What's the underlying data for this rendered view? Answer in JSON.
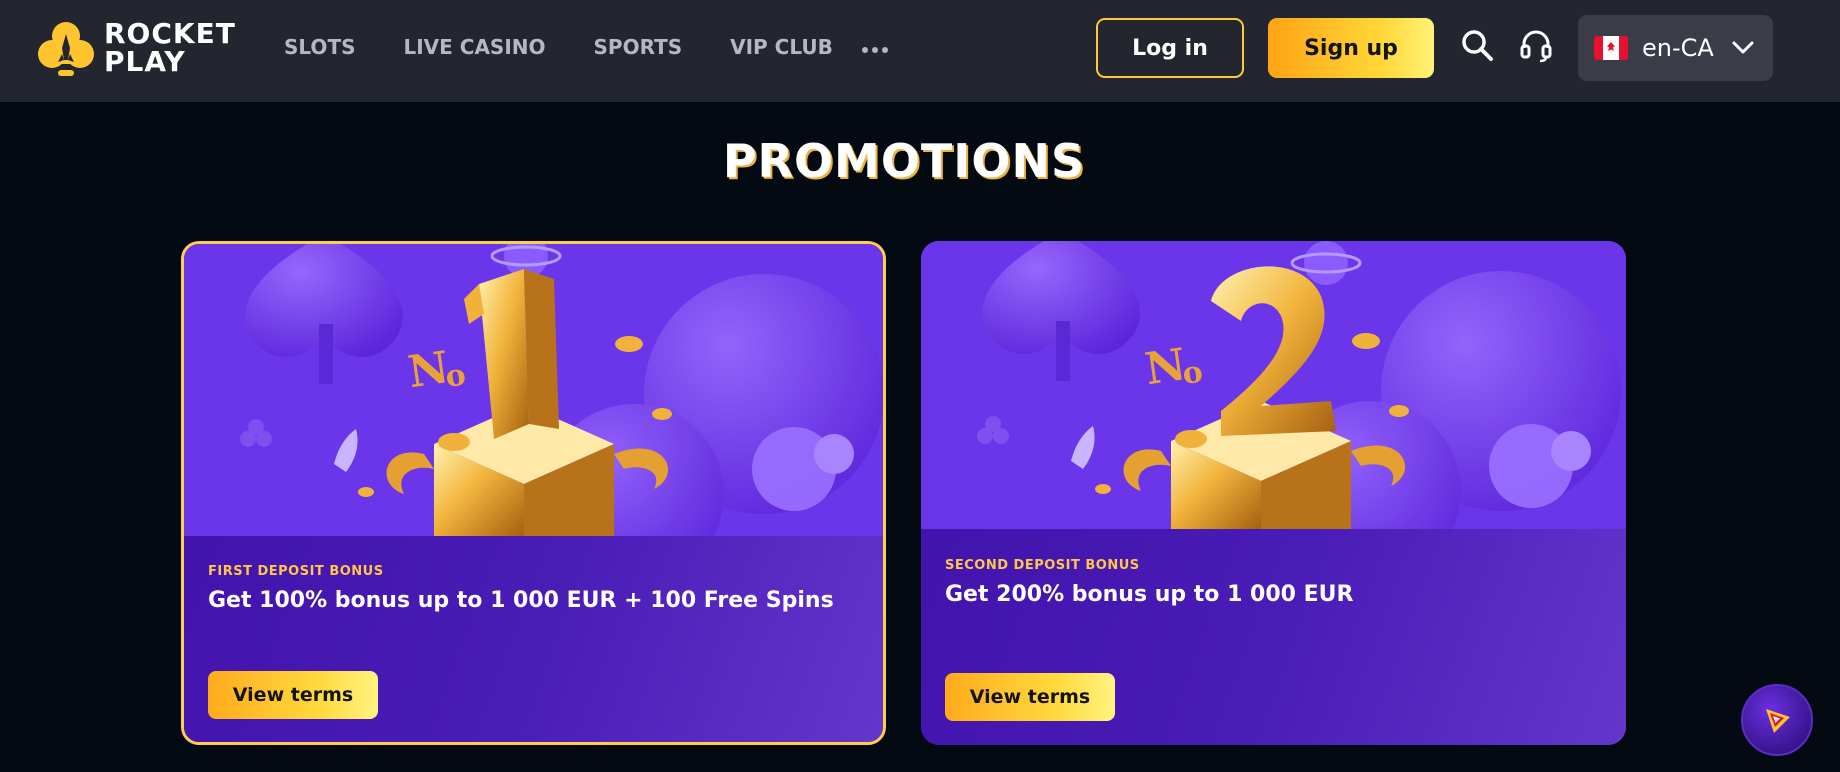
{
  "brand": {
    "line1": "ROCKET",
    "line2": "PLAY",
    "accent_color": "#ffc530"
  },
  "nav": {
    "items": [
      {
        "label": "SLOTS"
      },
      {
        "label": "LIVE CASINO"
      },
      {
        "label": "SPORTS"
      },
      {
        "label": "VIP CLUB"
      }
    ],
    "more_icon": "more-dots-icon"
  },
  "header": {
    "login_label": "Log in",
    "signup_label": "Sign up",
    "search_icon": "search-icon",
    "support_icon": "headset-icon",
    "language": {
      "flag": "canada-flag-icon",
      "label": "en-CA",
      "chevron": "chevron-down-icon"
    }
  },
  "page": {
    "title": "PROMOTIONS"
  },
  "promotions": [
    {
      "badge": "No1",
      "label": "FIRST DEPOSIT BONUS",
      "headline": "Get 100% bonus up to 1 000 EUR + 100 Free Spins",
      "button_label": "View terms",
      "selected": true
    },
    {
      "badge": "No2",
      "label": "SECOND DEPOSIT BONUS",
      "headline": "Get 200% bonus up to 1 000 EUR",
      "button_label": "View terms",
      "selected": false
    }
  ],
  "widget": {
    "icon": "rocket-play-chat-icon"
  },
  "colors": {
    "header_bg": "#23262e",
    "page_bg": "#030a12",
    "card_purple": "#4a1cb6",
    "gold": "#ffc83d"
  }
}
